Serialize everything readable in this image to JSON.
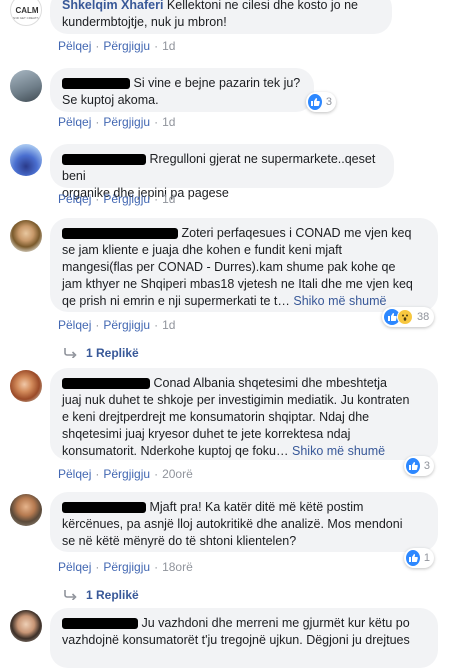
{
  "labels": {
    "reply": "Përgjigju",
    "like": "Pëlqej",
    "dot": "·",
    "see_more": "Shiko më shumë"
  },
  "comments": [
    {
      "author": "Shkelqim Xhaferi",
      "text_lines": [
        "Kellektoni ne cilesi dhe kosto jo ne",
        "kundermbtojtje, nuk ju mbron!"
      ],
      "time": "1d"
    },
    {
      "text_lines": [
        "Si vine e bejne pazarin tek ju?",
        "Se kuptoj akoma."
      ],
      "time": "1d",
      "reaction_count": "3"
    },
    {
      "text_lines": [
        "Rregulloni gjerat ne supermarkete..qeset beni",
        "organike dhe jepini pa pagese"
      ],
      "time": "1d"
    },
    {
      "text_lines": [
        "Zoteri perfaqesues i CONAD me vjen keq",
        "se jam kliente e juaja dhe kohen e fundit keni mjaft",
        "mangesi(flas per CONAD - Durres).kam shume pak kohe qe",
        "jam kthyer ne Shqiperi mbas18 vjetesh ne Itali dhe me vjen keq",
        "qe prish ni emrin e nji supermerkati te t…"
      ],
      "time": "1d",
      "reaction_count": "38",
      "replies": "1 Replikë"
    },
    {
      "text_lines": [
        "Conad Albania shqetesimi dhe mbeshtetja",
        "juaj nuk duhet te shkoje per investigimin mediatik. Ju kontraten",
        "e keni drejtperdrejt me konsumatorin shqiptar. Ndaj dhe",
        "shqetesimi juaj kryesor duhet te jete korrektesa ndaj",
        "konsumatorit. Nderkohe kuptoj qe foku…"
      ],
      "time": "20orë",
      "reaction_count": "3"
    },
    {
      "text_lines": [
        "Mjaft pra! Ka katër ditë më këtë postim",
        "kërcënues, pa asnjë lloj autokritikë dhe analizë. Mos mendoni",
        "se në këtë mënyrë do të shtoni klientelen?"
      ],
      "time": "18orë",
      "reaction_count": "1",
      "replies": "1 Replikë"
    },
    {
      "text_lines": [
        "Ju vazhdoni dhe merreni me gjurmët kur këtu po",
        "vazhdojnë konsumatorët t'ju tregojnë ujkun. Dëgjoni ju drejtues"
      ]
    }
  ],
  "colors": {
    "link": "#385898",
    "bubble": "#f2f3f5",
    "like_blue": "#2d88ff",
    "muted": "#90949c"
  },
  "icons": [
    "like-icon",
    "wow-icon",
    "reply-arrow-icon"
  ]
}
